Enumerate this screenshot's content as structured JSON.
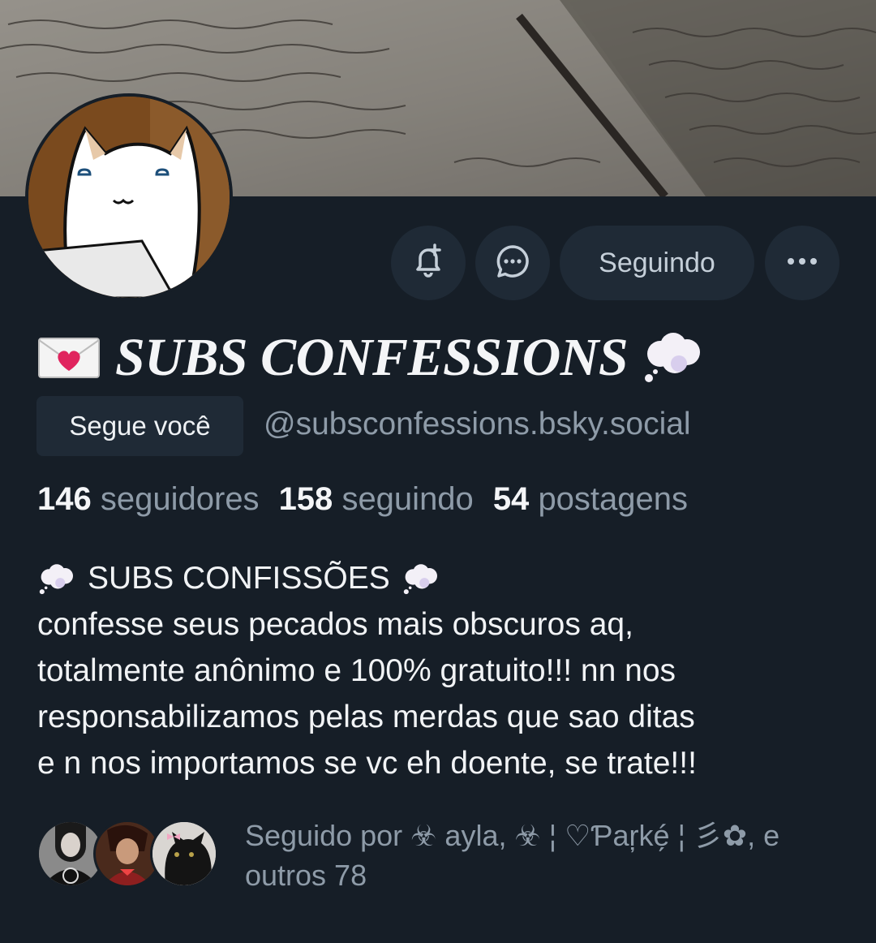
{
  "profile": {
    "display_name": "SUBS CONFESSIONS",
    "follows_you_label": "Segue você",
    "handle": "@subsconfessions.bsky.social",
    "following_button_label": "Seguindo",
    "stats": {
      "followers_count": "146",
      "followers_label": "seguidores",
      "following_count": "158",
      "following_label": "seguindo",
      "posts_count": "54",
      "posts_label": "postagens"
    },
    "bio": {
      "title": "SUBS CONFISSÕES",
      "line1": "confesse seus pecados mais obscuros aq,",
      "line2": "totalmente anônimo e 100% gratuito!!! nn nos",
      "line3": "responsabilizamos pelas merdas que sao ditas",
      "line4": "e n nos importamos se vc eh doente, se trate!!!"
    },
    "followed_by_text": "Seguido por ☣ ayla, ☣ ¦ ♡Ƥar̦ké̗ ¦ 彡✿, e outros 78"
  },
  "icons": {
    "notify": "bell-plus-icon",
    "message": "chat-bubble-icon",
    "more": "ellipsis-icon",
    "name_left_emoji": "love-letter-icon",
    "name_right_emoji": "thought-balloon-icon"
  },
  "colors": {
    "background": "#161e27",
    "button_bg": "#1f2a36",
    "muted_text": "#8e9ba8",
    "primary_text": "#f1f3f5"
  }
}
